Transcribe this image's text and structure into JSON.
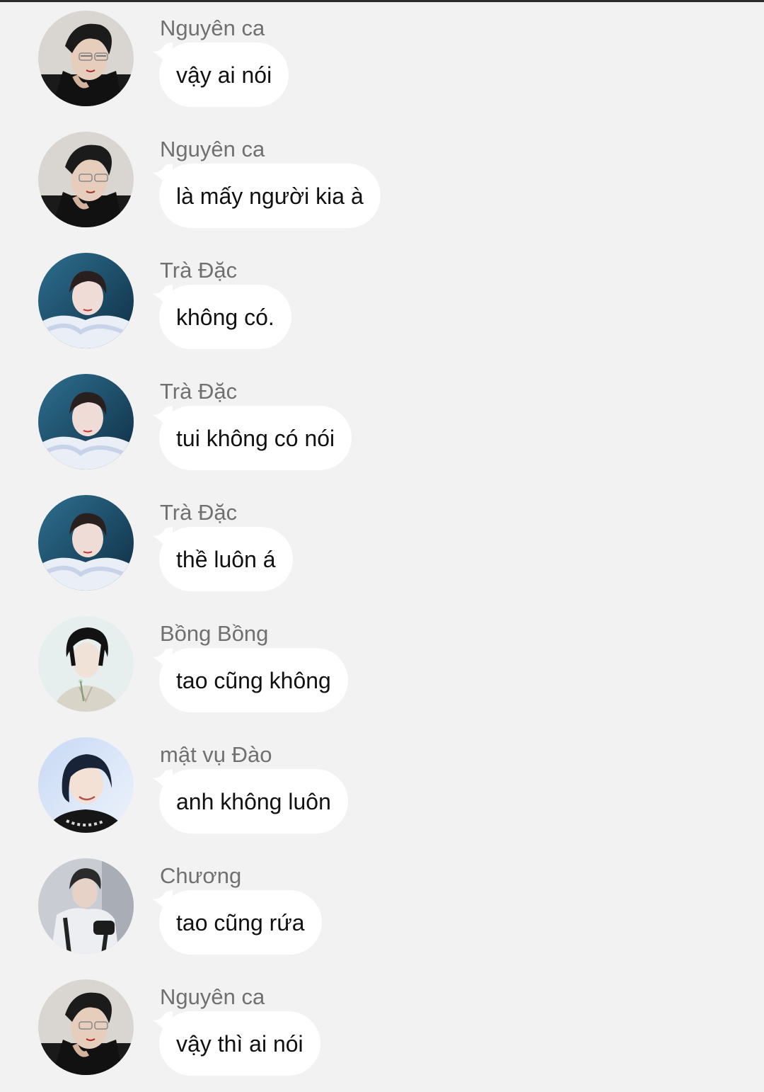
{
  "messages": [
    {
      "sender": "Nguyên ca",
      "text": "vậy ai nói",
      "avatar": "nguyen-ca-avatar"
    },
    {
      "sender": "Nguyên ca",
      "text": "là mấy người kia à",
      "avatar": "nguyen-ca-avatar"
    },
    {
      "sender": "Trà Đặc",
      "text": "không có.",
      "avatar": "tra-dac-avatar"
    },
    {
      "sender": "Trà Đặc",
      "text": "tui không có nói",
      "avatar": "tra-dac-avatar"
    },
    {
      "sender": "Trà Đặc",
      "text": "thề luôn á",
      "avatar": "tra-dac-avatar"
    },
    {
      "sender": "Bồng Bồng",
      "text": "tao cũng không",
      "avatar": "bong-bong-avatar"
    },
    {
      "sender": "mật vụ Đào",
      "text": "anh không luôn",
      "avatar": "mat-vu-dao-avatar"
    },
    {
      "sender": "Chương",
      "text": "tao cũng rứa",
      "avatar": "chuong-avatar"
    },
    {
      "sender": "Nguyên ca",
      "text": "vậy thì ai nói",
      "avatar": "nguyen-ca-avatar"
    }
  ],
  "colors": {
    "background": "#f2f2f2",
    "bubble": "#ffffff",
    "sender_name": "#707070",
    "message_text": "#111111"
  }
}
